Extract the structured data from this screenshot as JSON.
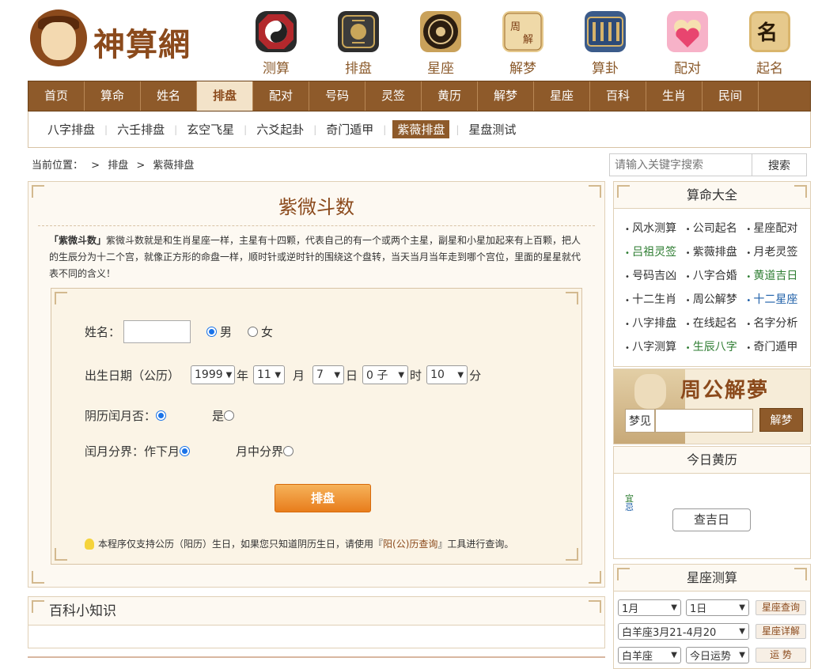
{
  "site": {
    "logo_text": "神算網"
  },
  "topnav": [
    {
      "label": "测算",
      "icon": "taiji-icon",
      "color": "#c2383b"
    },
    {
      "label": "排盘",
      "icon": "bagua-icon",
      "color": "#3b3b3b"
    },
    {
      "label": "星座",
      "icon": "compass-icon",
      "color": "#3a2a1a"
    },
    {
      "label": "解梦",
      "icon": "dream-icon",
      "color": "#c99a50"
    },
    {
      "label": "算卦",
      "icon": "abacus-icon",
      "color": "#3b5b8a"
    },
    {
      "label": "配对",
      "icon": "couple-icon",
      "color": "#e85c8c"
    },
    {
      "label": "起名",
      "icon": "name-icon",
      "color": "#c9a15a"
    }
  ],
  "mainnav": [
    "首页",
    "算命",
    "姓名",
    "排盘",
    "配对",
    "号码",
    "灵签",
    "黄历",
    "解梦",
    "星座",
    "百科",
    "生肖",
    "民间"
  ],
  "mainnav_active": "排盘",
  "subnav": [
    "八字排盘",
    "六壬排盘",
    "玄空飞星",
    "六爻起卦",
    "奇门遁甲",
    "紫薇排盘",
    "星盘测试"
  ],
  "subnav_active": "紫薇排盘",
  "breadcrumb": {
    "prefix": "当前位置：",
    "sep": ">",
    "level1": "排盘",
    "level2": "紫薇排盘"
  },
  "search": {
    "placeholder": "请输入关键字搜索",
    "button": "搜索"
  },
  "panel": {
    "title": "紫微斗数",
    "desc_bold": "「紫微斗数」",
    "desc": "紫微斗数就是和生肖星座一样，主星有十四颗，代表自己的有一个或两个主星，副星和小星加起来有上百颗，把人的生辰分为十二个宫，就像正方形的命盘一样，顺时针或逆时针的围绕这个盘转，当天当月当年走到哪个宫位，里面的星星就代表不同的含义！"
  },
  "form": {
    "name_label": "姓名：",
    "male": "男",
    "female": "女",
    "birth_label": "出生日期（公历）",
    "year": "1999",
    "year_unit": "年",
    "month": "11",
    "month_unit": "月",
    "day": "7",
    "day_unit": "日",
    "hour": "0 子",
    "hour_unit": "时",
    "minute": "10",
    "minute_unit": "分",
    "leap_label": "阴历闰月否：",
    "leap_yes": "是",
    "split_label": "闰月分界：",
    "split_opt1": "作下月",
    "split_opt2": "月中分界",
    "submit": "排盘",
    "tip_pre": "本程序仅支持公历（阳历）生日，如果您只知道阴历生日，请使用『",
    "tip_link": "阳(公)历查询",
    "tip_post": "』工具进行查询。"
  },
  "baike": {
    "title": "百科小知识"
  },
  "sidebar": {
    "suanming": {
      "title": "算命大全",
      "items": [
        {
          "label": "风水测算",
          "style": ""
        },
        {
          "label": "公司起名",
          "style": ""
        },
        {
          "label": "星座配对",
          "style": ""
        },
        {
          "label": "吕祖灵签",
          "style": "green"
        },
        {
          "label": "紫薇排盘",
          "style": ""
        },
        {
          "label": "月老灵签",
          "style": ""
        },
        {
          "label": "号码吉凶",
          "style": ""
        },
        {
          "label": "八字合婚",
          "style": ""
        },
        {
          "label": "黄道吉日",
          "style": "green"
        },
        {
          "label": "十二生肖",
          "style": ""
        },
        {
          "label": "周公解梦",
          "style": ""
        },
        {
          "label": "十二星座",
          "style": "blue"
        },
        {
          "label": "八字排盘",
          "style": ""
        },
        {
          "label": "在线起名",
          "style": ""
        },
        {
          "label": "名字分析",
          "style": ""
        },
        {
          "label": "八字测算",
          "style": ""
        },
        {
          "label": "生辰八字",
          "style": "green"
        },
        {
          "label": "奇门遁甲",
          "style": ""
        }
      ]
    },
    "dream": {
      "title": "周公解夢",
      "input_label": "梦见",
      "button": "解梦"
    },
    "huangli": {
      "title": "今日黄历",
      "mark": "宜",
      "mark2": "忌",
      "button": "查吉日"
    },
    "astro": {
      "title": "星座测算",
      "month": "1月",
      "day": "1日",
      "btn1": "星座查询",
      "sign_range": "白羊座3月21-4月20",
      "btn2": "星座详解",
      "sign": "白羊座",
      "fortune": "今日运势",
      "btn3": "运 势"
    }
  }
}
